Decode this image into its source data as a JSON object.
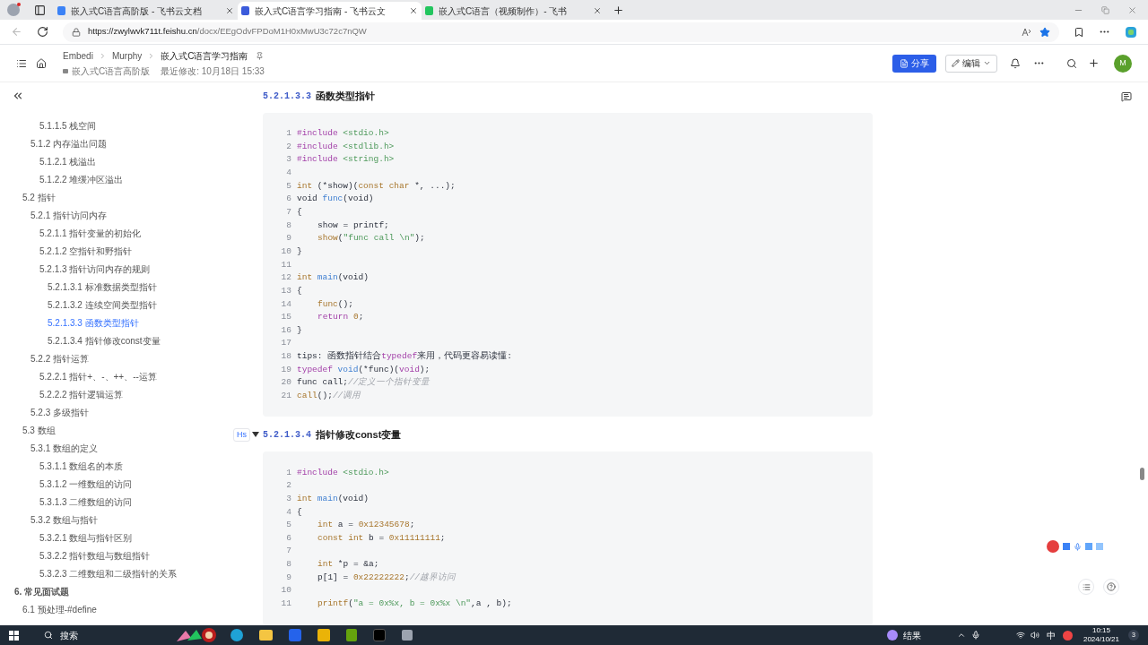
{
  "browser": {
    "tabs": [
      {
        "title": "嵌入式C语言高阶版 - 飞书云文档",
        "selected": false,
        "color": "#3b82f6"
      },
      {
        "title": "嵌入式C语言学习指南 - 飞书云文",
        "selected": true,
        "color": "#3b5bdb"
      },
      {
        "title": "嵌入式C语言（视频制作）- 飞书",
        "selected": false,
        "color": "#22c55e"
      }
    ],
    "url_host": "https://zwylwvk711t.feishu.cn",
    "url_path": "/docx/EEgOdvFPDoM1H0xMwU3c72c7nQW"
  },
  "doc_header": {
    "breadcrumb": [
      "Embedi",
      "Murphy",
      "嵌入式C语言学习指南"
    ],
    "parent": "嵌入式C语言高阶版",
    "modified": "最近修改: 10月18日 15:33",
    "share": "分享",
    "edit": "编辑"
  },
  "avatar": "M",
  "outline": [
    {
      "children": [
        {
          "children": [
            {
              "children": [
                {
                  "label": "5.1.1.5 栈空间",
                  "selected": false
                }
              ]
            },
            {
              "label": "5.1.2 内存溢出问题",
              "selected": false,
              "children": [
                {
                  "label": "5.1.2.1 栈溢出",
                  "selected": false
                },
                {
                  "label": "5.1.2.2 堆缓冲区溢出",
                  "selected": false
                }
              ]
            }
          ]
        },
        {
          "label": "5.2 指针",
          "selected": false,
          "children": [
            {
              "label": "5.2.1 指针访问内存",
              "selected": false,
              "children": [
                {
                  "label": "5.2.1.1 指针变量的初始化",
                  "selected": false
                },
                {
                  "label": "5.2.1.2 空指针和野指针",
                  "selected": false
                },
                {
                  "label": "5.2.1.3 指针访问内存的规则",
                  "selected": false,
                  "children": [
                    {
                      "label": "5.2.1.3.1 标准数据类型指针",
                      "selected": false
                    },
                    {
                      "label": "5.2.1.3.2 连续空间类型指针",
                      "selected": false
                    },
                    {
                      "label": "5.2.1.3.3 函数类型指针",
                      "selected": true
                    },
                    {
                      "label": "5.2.1.3.4 指针修改const变量",
                      "selected": false
                    }
                  ]
                }
              ]
            },
            {
              "label": "5.2.2 指针运算",
              "selected": false,
              "children": [
                {
                  "label": "5.2.2.1 指针+、-、++、--运算",
                  "selected": false
                },
                {
                  "label": "5.2.2.2 指针逻辑运算",
                  "selected": false
                }
              ]
            },
            {
              "label": "5.2.3 多级指针",
              "selected": false
            }
          ]
        },
        {
          "label": "5.3 数组",
          "selected": false,
          "children": [
            {
              "label": "5.3.1 数组的定义",
              "selected": false,
              "children": [
                {
                  "label": "5.3.1.1 数组名的本质",
                  "selected": false
                },
                {
                  "label": "5.3.1.2 一维数组的访问",
                  "selected": false
                },
                {
                  "label": "5.3.1.3 二维数组的访问",
                  "selected": false
                }
              ]
            },
            {
              "label": "5.3.2 数组与指针",
              "selected": false,
              "children": [
                {
                  "label": "5.3.2.1 数组与指针区别",
                  "selected": false
                },
                {
                  "label": "5.3.2.2 指针数组与数组指针",
                  "selected": false
                },
                {
                  "label": "5.3.2.3 二维数组和二级指针的关系",
                  "selected": false
                }
              ]
            }
          ]
        }
      ]
    },
    {
      "label": "6. 常见面试题",
      "selected": false,
      "children": [
        {
          "label": "6.1 预处理-#define",
          "selected": false
        }
      ]
    }
  ],
  "sections": [
    {
      "number": "5.2.1.3.3",
      "title": "函数类型指针",
      "lines": [
        {
          "n": "1",
          "tokens": [
            {
              "kind": "kw",
              "text": "#include "
            },
            {
              "kind": "str",
              "text": "<stdio.h>"
            }
          ]
        },
        {
          "n": "2",
          "tokens": [
            {
              "kind": "kw",
              "text": "#include "
            },
            {
              "kind": "str",
              "text": "<stdlib.h>"
            }
          ]
        },
        {
          "n": "3",
          "tokens": [
            {
              "kind": "kw",
              "text": "#include "
            },
            {
              "kind": "str",
              "text": "<string.h>"
            }
          ]
        },
        {
          "n": "4"
        },
        {
          "n": "5",
          "tokens": [
            {
              "kind": "num",
              "text": "int"
            },
            {
              "kind": "plain",
              "text": " (*show)("
            },
            {
              "kind": "num",
              "text": "const char"
            },
            {
              "kind": "plain",
              "text": " *, ...);"
            }
          ]
        },
        {
          "n": "6",
          "tokens": [
            {
              "kind": "plain",
              "text": "void "
            },
            {
              "kind": "fn",
              "text": "func"
            },
            {
              "kind": "plain",
              "text": "(void)"
            }
          ]
        },
        {
          "n": "7",
          "tokens": [
            {
              "kind": "plain",
              "text": "{"
            }
          ]
        },
        {
          "n": "8",
          "indent": true,
          "tokens": [
            {
              "kind": "plain",
              "text": "show = printf;"
            }
          ]
        },
        {
          "n": "9",
          "indent": true,
          "tokens": [
            {
              "kind": "num",
              "text": "show"
            },
            {
              "kind": "plain",
              "text": "("
            },
            {
              "kind": "str",
              "text": "\"func call \\n\""
            },
            {
              "kind": "plain",
              "text": ");"
            }
          ]
        },
        {
          "n": "10",
          "tokens": [
            {
              "kind": "plain",
              "text": "}"
            }
          ]
        },
        {
          "n": "11"
        },
        {
          "n": "12",
          "tokens": [
            {
              "kind": "num",
              "text": "int "
            },
            {
              "kind": "fn",
              "text": "main"
            },
            {
              "kind": "plain",
              "text": "(void)"
            }
          ]
        },
        {
          "n": "13",
          "tokens": [
            {
              "kind": "plain",
              "text": "{"
            }
          ]
        },
        {
          "n": "14",
          "indent": true,
          "tokens": [
            {
              "kind": "num",
              "text": "func"
            },
            {
              "kind": "plain",
              "text": "();"
            }
          ]
        },
        {
          "n": "15",
          "indent": true,
          "tokens": [
            {
              "kind": "kw",
              "text": "return "
            },
            {
              "kind": "num",
              "text": "0"
            },
            {
              "kind": "plain",
              "text": ";"
            }
          ]
        },
        {
          "n": "16",
          "tokens": [
            {
              "kind": "plain",
              "text": "}"
            }
          ]
        },
        {
          "n": "17"
        },
        {
          "n": "18",
          "tokens": [
            {
              "kind": "plain",
              "text": "tips: 函数指针结合"
            },
            {
              "kind": "kw",
              "text": "typedef"
            },
            {
              "kind": "plain",
              "text": "来用，代码更容易读懂:"
            }
          ]
        },
        {
          "n": "19",
          "tokens": [
            {
              "kind": "kw",
              "text": "typedef "
            },
            {
              "kind": "fn",
              "text": "void"
            },
            {
              "kind": "plain",
              "text": "(*func)("
            },
            {
              "kind": "kw",
              "text": "void"
            },
            {
              "kind": "plain",
              "text": ");"
            }
          ]
        },
        {
          "n": "20",
          "tokens": [
            {
              "kind": "plain",
              "text": "func call;"
            },
            {
              "kind": "cm",
              "text": "//定义一个指针变量"
            }
          ]
        },
        {
          "n": "21",
          "tokens": [
            {
              "kind": "num",
              "text": "call"
            },
            {
              "kind": "plain",
              "text": "();"
            },
            {
              "kind": "cm",
              "text": "//调用"
            }
          ]
        }
      ]
    },
    {
      "number": "5.2.1.3.4",
      "title": "指针修改const变量",
      "handle_label": "Hs",
      "lines": [
        {
          "n": "1",
          "tokens": [
            {
              "kind": "kw",
              "text": "#include "
            },
            {
              "kind": "str",
              "text": "<stdio.h>"
            }
          ]
        },
        {
          "n": "2"
        },
        {
          "n": "3",
          "tokens": [
            {
              "kind": "num",
              "text": "int "
            },
            {
              "kind": "fn",
              "text": "main"
            },
            {
              "kind": "plain",
              "text": "(void)"
            }
          ]
        },
        {
          "n": "4",
          "tokens": [
            {
              "kind": "plain",
              "text": "{"
            }
          ]
        },
        {
          "n": "5",
          "indent": true,
          "tokens": [
            {
              "kind": "num",
              "text": "int"
            },
            {
              "kind": "plain",
              "text": " a = "
            },
            {
              "kind": "num",
              "text": "0x12345678"
            },
            {
              "kind": "plain",
              "text": ";"
            }
          ]
        },
        {
          "n": "6",
          "indent": true,
          "tokens": [
            {
              "kind": "num",
              "text": "const int"
            },
            {
              "kind": "plain",
              "text": " b = "
            },
            {
              "kind": "num",
              "text": "0x11111111"
            },
            {
              "kind": "plain",
              "text": ";"
            }
          ]
        },
        {
          "n": "7"
        },
        {
          "n": "8",
          "indent": true,
          "tokens": [
            {
              "kind": "num",
              "text": "int"
            },
            {
              "kind": "plain",
              "text": " *p = &a;"
            }
          ]
        },
        {
          "n": "9",
          "indent": true,
          "tokens": [
            {
              "kind": "plain",
              "text": "p[1] = "
            },
            {
              "kind": "num",
              "text": "0x22222222"
            },
            {
              "kind": "plain",
              "text": ";"
            },
            {
              "kind": "cm",
              "text": "//越界访问"
            }
          ]
        },
        {
          "n": "10"
        },
        {
          "n": "11",
          "indent": true,
          "tokens": [
            {
              "kind": "num",
              "text": "printf"
            },
            {
              "kind": "plain",
              "text": "("
            },
            {
              "kind": "str",
              "text": "\"a = 0x%x, b = 0x%x \\n\""
            },
            {
              "kind": "plain",
              "text": ",a , b);"
            }
          ]
        }
      ]
    }
  ],
  "taskbar": {
    "search": "搜索",
    "weather": "结果",
    "ime": "中",
    "time": "10:15",
    "date": "2024/10/21",
    "notifications": "3"
  }
}
